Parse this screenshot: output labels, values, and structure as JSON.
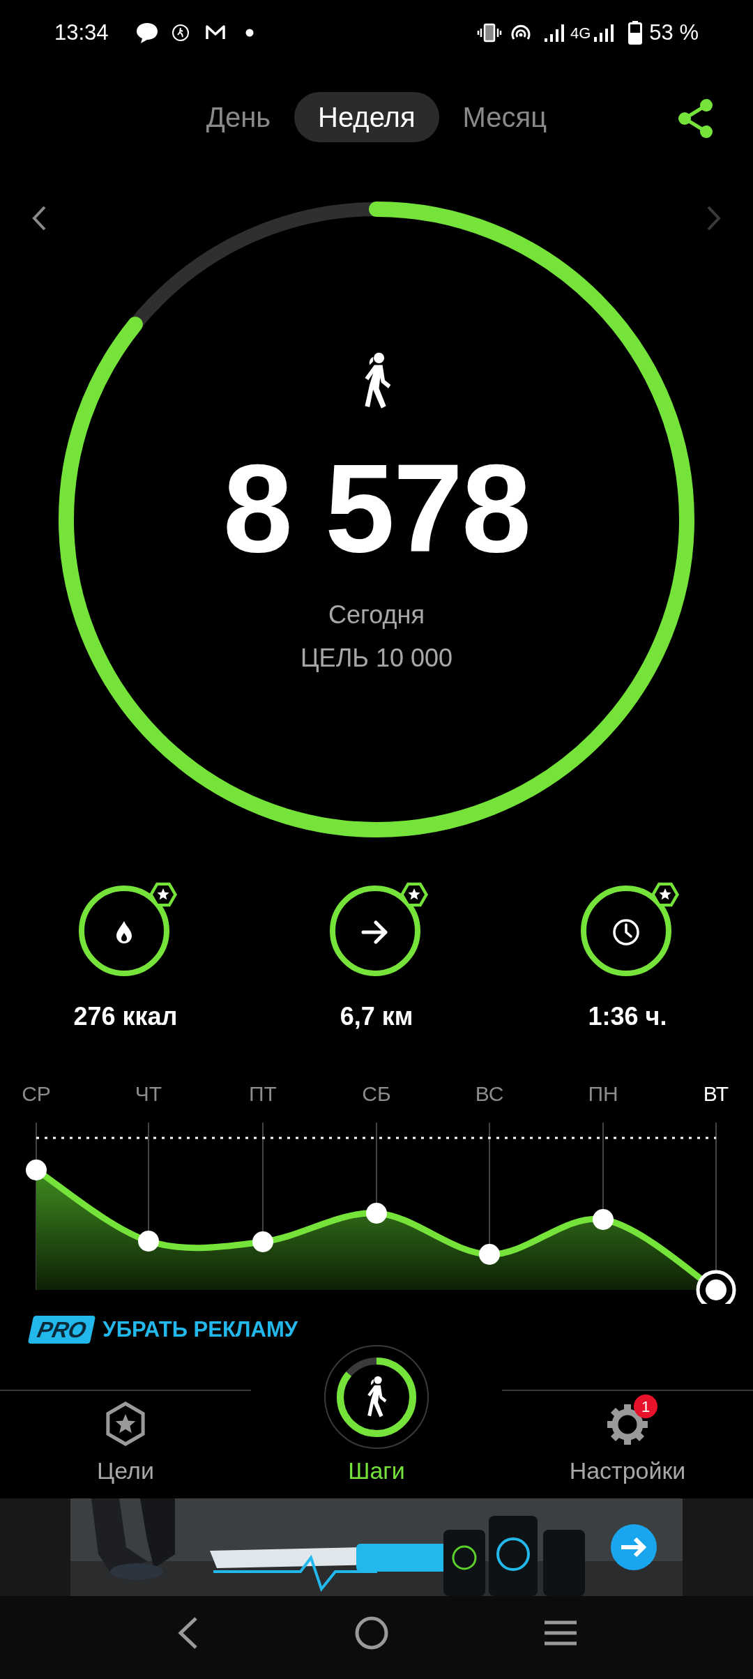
{
  "status_bar": {
    "time": "13:34",
    "network": "4G",
    "battery": "53 %"
  },
  "period_tabs": [
    {
      "label": "День",
      "selected": false
    },
    {
      "label": "Неделя",
      "selected": true
    },
    {
      "label": "Месяц",
      "selected": false
    }
  ],
  "pager": {
    "prev_disabled": false,
    "next_disabled": true
  },
  "steps": {
    "level": 0.858,
    "count": "8 578",
    "caption": "Сегодня",
    "goal": "ЦЕЛЬ 10 000"
  },
  "stats": [
    {
      "kind": "flame",
      "value": "276 ккал"
    },
    {
      "kind": "distance",
      "value": "6,7 км"
    },
    {
      "kind": "time",
      "value": "1:36 ч."
    }
  ],
  "week_days": [
    {
      "label": "СР",
      "selected": false
    },
    {
      "label": "ЧТ",
      "selected": false
    },
    {
      "label": "ПТ",
      "selected": false
    },
    {
      "label": "СБ",
      "selected": false
    },
    {
      "label": "ВС",
      "selected": false
    },
    {
      "label": "ПН",
      "selected": false
    },
    {
      "label": "ВТ",
      "selected": true
    }
  ],
  "pro_link": {
    "badge": "PRO",
    "label": "УБРАТЬ РЕКЛАМУ"
  },
  "bottom_nav": [
    {
      "kind": "goals",
      "label": "Цели",
      "selected": false
    },
    {
      "kind": "steps",
      "label": "Шаги",
      "selected": true,
      "level": 0.86
    },
    {
      "kind": "settings",
      "label": "Настройки",
      "selected": false,
      "badge": "1"
    }
  ]
}
